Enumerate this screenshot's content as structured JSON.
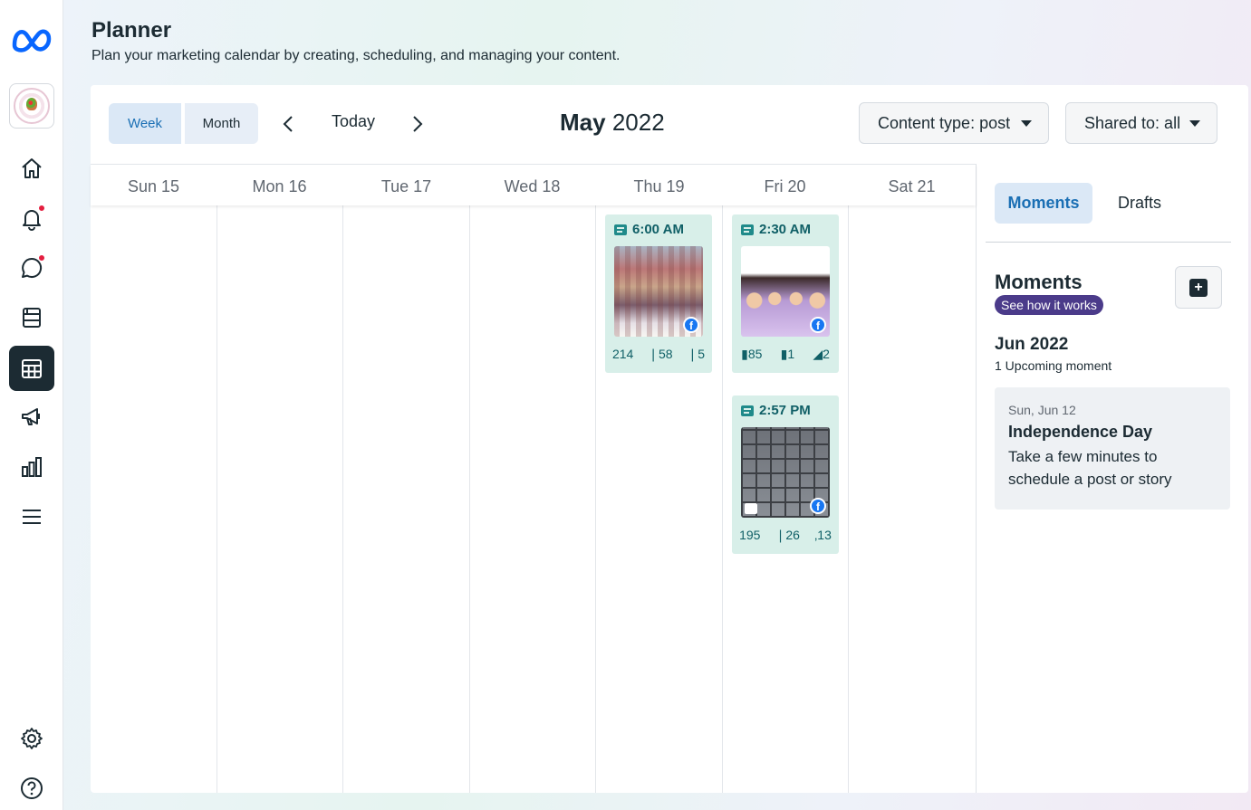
{
  "page": {
    "title": "Planner",
    "subtitle": "Plan your marketing calendar by creating, scheduling, and managing your content."
  },
  "nav": {
    "items": [
      "home-icon",
      "notifications-icon",
      "messages-icon",
      "content-icon",
      "planner-icon",
      "ads-icon",
      "insights-icon",
      "menu-icon",
      "settings-icon",
      "help-icon"
    ],
    "active": "planner-icon",
    "notification_dot_color": "#e41e3f"
  },
  "toolbar": {
    "week_label": "Week",
    "month_label": "Month",
    "today_label": "Today",
    "month_name": "May",
    "year": "2022",
    "content_type_label": "Content type: post",
    "shared_to_label": "Shared to: all"
  },
  "calendar": {
    "days": [
      "Sun 15",
      "Mon 16",
      "Tue 17",
      "Wed 18",
      "Thu 19",
      "Fri 20",
      "Sat 21"
    ],
    "posts": [
      {
        "day": "Thu 19",
        "time": "6:00 AM",
        "reach": "214",
        "engagement": "58",
        "shares": "5",
        "platform": "facebook"
      },
      {
        "day": "Fri 20",
        "time": "2:30 AM",
        "reach": "85",
        "engagement": "1",
        "shares": "2",
        "platform": "facebook"
      },
      {
        "day": "Fri 20",
        "time": "2:57 PM",
        "reach": "195",
        "engagement": "26",
        "shares": "13",
        "platform": "facebook"
      }
    ]
  },
  "panel": {
    "tabs": [
      "Moments",
      "Drafts"
    ],
    "active_tab": "Moments",
    "moments_title": "Moments",
    "see_how_label": "See how it works",
    "month_heading": "Jun 2022",
    "upcoming_text": "1 Upcoming moment",
    "moment": {
      "date": "Sun, Jun 12",
      "name": "Independence Day",
      "description": "Take a few minutes to schedule a post or story"
    }
  },
  "colors": {
    "accent": "#1a6fb4",
    "post_bg": "#d8efe9",
    "post_text": "#0f5f66",
    "badge": "#4b3b8a",
    "facebook": "#1877f2"
  }
}
